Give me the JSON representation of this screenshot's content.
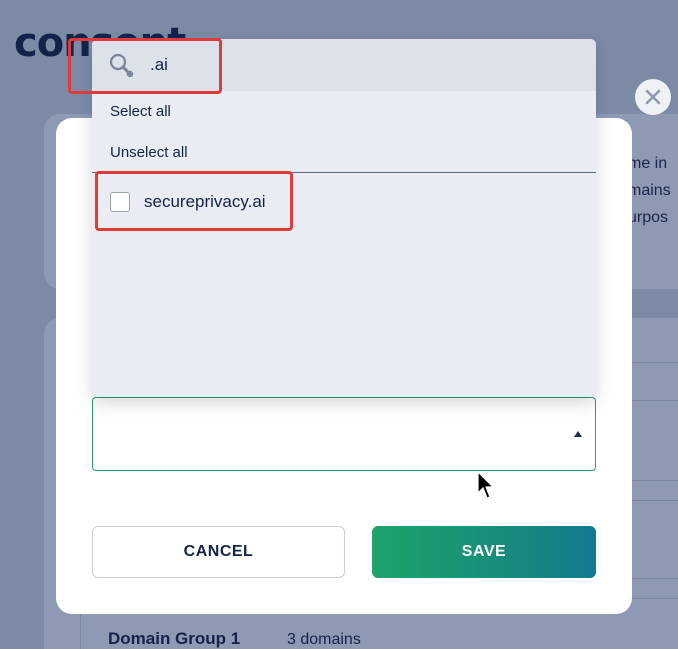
{
  "background": {
    "title": "consent",
    "card_text_lines": [
      "me in",
      "mains",
      "urpos"
    ],
    "group_name": "Domain Group 1",
    "group_count": "3 domains"
  },
  "dropdown": {
    "search_value": ".ai",
    "select_all": "Select all",
    "unselect_all": "Unselect all",
    "options": [
      {
        "label": "secureprivacy.ai",
        "checked": false
      }
    ]
  },
  "modal": {
    "cancel_label": "CANCEL",
    "save_label": "SAVE"
  },
  "colors": {
    "primary_green": "#1ea36b",
    "highlight_red": "#e03b3b",
    "text_dark": "#15234a"
  }
}
